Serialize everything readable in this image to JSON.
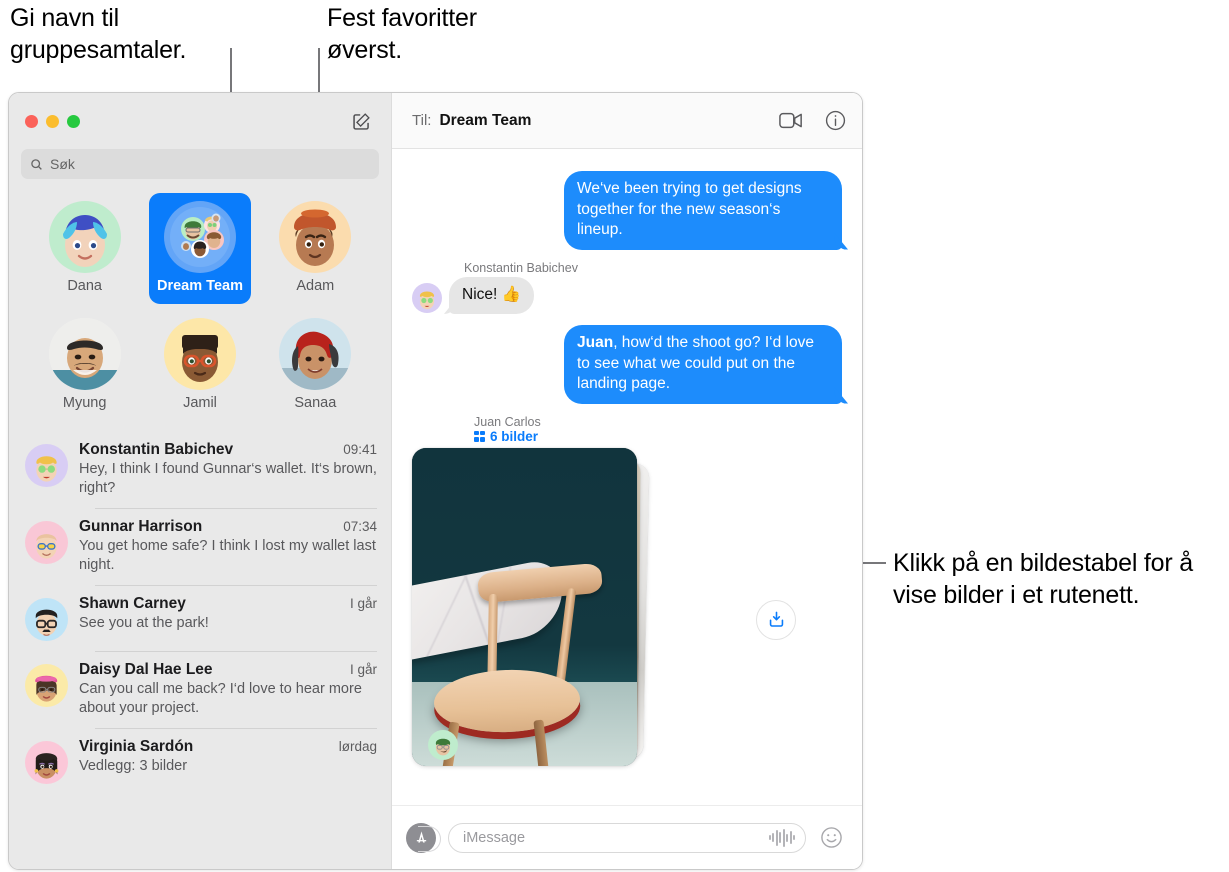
{
  "callouts": {
    "left": "Gi navn til gruppesamtaler.",
    "middle": "Fest favoritter øverst.",
    "right": "Klikk på en bildestabel for å vise bilder i et rutenett."
  },
  "window": {
    "traffic_lights": [
      "close",
      "minimize",
      "zoom"
    ]
  },
  "sidebar": {
    "compose_icon": "compose-icon",
    "search": {
      "icon": "search-icon",
      "placeholder": "Søk",
      "value": ""
    },
    "favorites": [
      {
        "label": "Dana",
        "avatar": "memoji-dana",
        "selected": false
      },
      {
        "label": "Dream Team",
        "avatar": "memoji-group",
        "selected": true
      },
      {
        "label": "Adam",
        "avatar": "memoji-adam",
        "selected": false
      },
      {
        "label": "Myung",
        "avatar": "photo-myung",
        "selected": false
      },
      {
        "label": "Jamil",
        "avatar": "memoji-jamil",
        "selected": false
      },
      {
        "label": "Sanaa",
        "avatar": "photo-sanaa",
        "selected": false
      }
    ],
    "conversations": [
      {
        "name": "Konstantin Babichev",
        "time": "09:41",
        "preview": "Hey, I think I found Gunnar‘s wallet. It‘s brown, right?",
        "avatar": "memoji-konstantin"
      },
      {
        "name": "Gunnar Harrison",
        "time": "07:34",
        "preview": "You get home safe? I think I lost my wallet last night.",
        "avatar": "memoji-gunnar"
      },
      {
        "name": "Shawn Carney",
        "time": "I går",
        "preview": "See you at the park!",
        "avatar": "memoji-shawn"
      },
      {
        "name": "Daisy Dal Hae Lee",
        "time": "I går",
        "preview": "Can you call me back? I‘d love to hear more about your project.",
        "avatar": "memoji-daisy"
      },
      {
        "name": "Virginia Sardón",
        "time": "lørdag",
        "preview": "Vedlegg: 3 bilder",
        "avatar": "memoji-virginia"
      }
    ]
  },
  "message_pane": {
    "header": {
      "to_label": "Til:",
      "to_value": "Dream Team",
      "facetime_icon": "video-camera-icon",
      "info_icon": "info-circle-icon"
    },
    "messages": [
      {
        "direction": "out",
        "text": "We‘ve been trying to get designs together for the new season‘s lineup."
      },
      {
        "direction": "in",
        "sender": "Konstantin Babichev",
        "text": "Nice! 👍",
        "avatar": "memoji-konstantin"
      },
      {
        "direction": "out",
        "bold_prefix": "Juan",
        "text": ", how‘d the shoot go? I‘d love to see what we could put on the landing page."
      }
    ],
    "photo_stack": {
      "sender": "Juan Carlos",
      "count_label": "6 bilder",
      "grid_icon": "grid-icon",
      "download_icon": "download-icon",
      "avatar": "memoji-juan"
    },
    "composer": {
      "apps_icon": "app-store-icon",
      "placeholder": "iMessage",
      "value": "",
      "audio_icon": "audio-waveform-icon",
      "emoji_icon": "smiley-face-icon"
    }
  },
  "colors": {
    "accent_blue": "#0a7cfb",
    "bubble_out": "#1d8cfc",
    "bubble_in": "#e6e6e6",
    "sidebar_bg": "#e9e9e9"
  }
}
